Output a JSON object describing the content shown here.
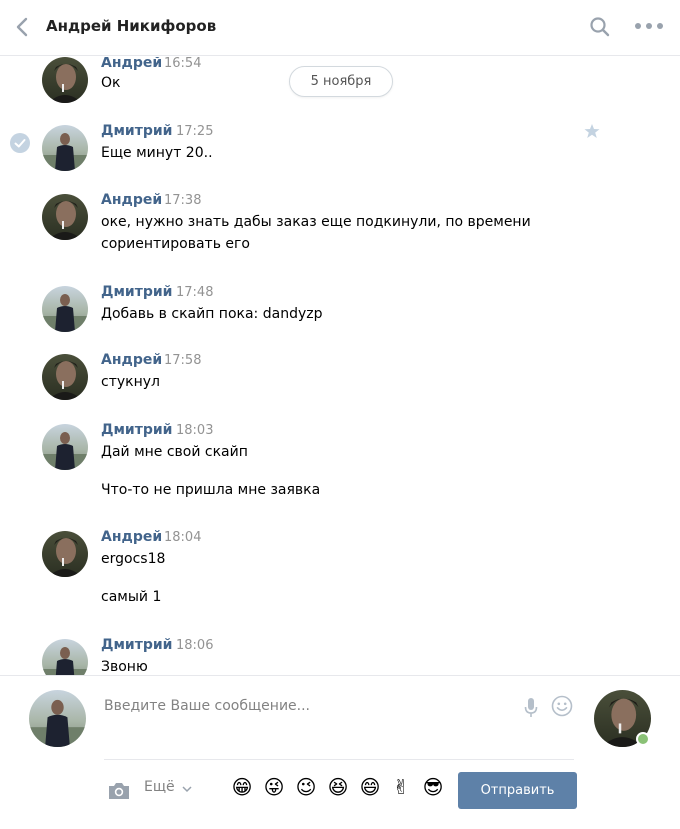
{
  "header": {
    "title": "Андрей Никифоров"
  },
  "date_divider": "5 ноября",
  "messages": [
    {
      "author": "Андрей",
      "time": "16:54",
      "lines": [
        "Ок"
      ]
    },
    {
      "author": "Дмитрий",
      "time": "17:25",
      "lines": [
        "Еще минут 20.."
      ],
      "selected": true
    },
    {
      "author": "Андрей",
      "time": "17:38",
      "lines": [
        "оке, нужно знать дабы заказ еще подкинули, по времени",
        "сориентировать его"
      ]
    },
    {
      "author": "Дмитрий",
      "time": "17:48",
      "lines": [
        "Добавь в скайп пока: dandyzp"
      ]
    },
    {
      "author": "Андрей",
      "time": "17:58",
      "lines": [
        "стукнул"
      ]
    },
    {
      "author": "Дмитрий",
      "time": "18:03",
      "lines": [
        "Дай мне свой скайп",
        "Что-то не пришла мне заявка"
      ]
    },
    {
      "author": "Андрей",
      "time": "18:04",
      "lines": [
        "ergocs18",
        "самый 1"
      ]
    },
    {
      "author": "Дмитрий",
      "time": "18:06",
      "lines": [
        "Звоню"
      ]
    }
  ],
  "composer": {
    "placeholder": "Введите Ваше сообщение...",
    "more_label": "Ещё",
    "send_label": "Отправить",
    "emoji": [
      "😁",
      "😜",
      "😉",
      "😆",
      "😄",
      "✌",
      "😎"
    ]
  },
  "colors": {
    "author": "#42648b",
    "send_button": "#5e81a8",
    "online": "#8ac176"
  }
}
